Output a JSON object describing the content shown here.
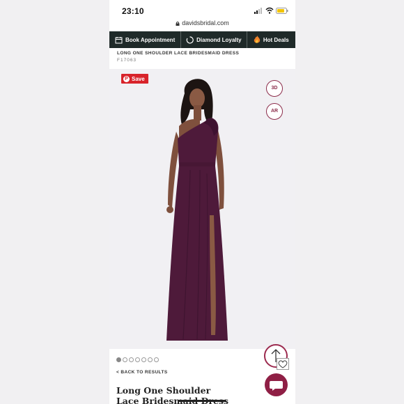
{
  "status_bar": {
    "time": "23:10"
  },
  "browser": {
    "url": "davidsbridal.com"
  },
  "nav": [
    {
      "label": "Book Appointment",
      "icon": "calendar-icon"
    },
    {
      "label": "Diamond Loyalty",
      "icon": "loading-ring-icon"
    },
    {
      "label": "Hot Deals",
      "icon": "flame-icon"
    }
  ],
  "product": {
    "title_caps": "LONG ONE SHOULDER LACE BRIDESMAID DRESS",
    "sku": "F17063",
    "title": "Long One Shoulder Lace Bridesmaid Dress"
  },
  "gallery": {
    "save_label": "Save",
    "btn_3d": "3D",
    "btn_ar": "AR",
    "dress_color": "#4e1a3a",
    "image_count": 7,
    "active_index": 0
  },
  "back_label": "< BACK TO RESULTS",
  "colors": {
    "nav_bg": "#1f2a29",
    "accent": "#8f1f45",
    "save_red": "#d8232a"
  }
}
